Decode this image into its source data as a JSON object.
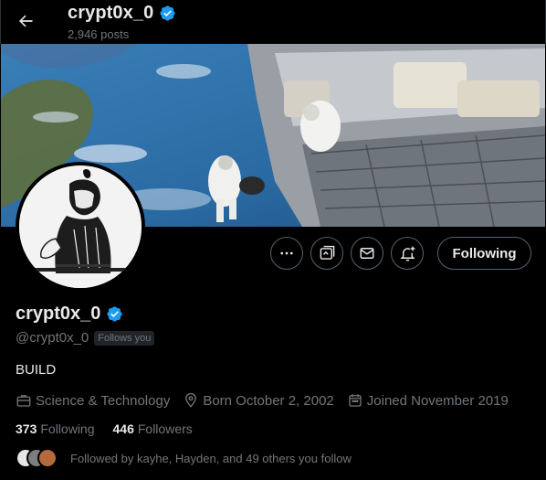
{
  "header": {
    "title": "crypt0x_0",
    "posts": "2,946 posts"
  },
  "profile": {
    "name": "crypt0x_0",
    "handle": "@crypt0x_0",
    "follows_you": "Follows you",
    "bio": "BUILD",
    "category": "Science & Technology",
    "born": "Born October 2, 2002",
    "joined": "Joined November 2019",
    "following_count": "373",
    "following_label": "Following",
    "followers_count": "446",
    "followers_label": "Followers",
    "followed_by": "Followed by kayhe, Hayden, and 49 others you follow"
  },
  "actions": {
    "follow_state": "Following"
  },
  "colors": {
    "verified": "#1d9bf0",
    "muted": "#71767b",
    "border": "#536471"
  }
}
